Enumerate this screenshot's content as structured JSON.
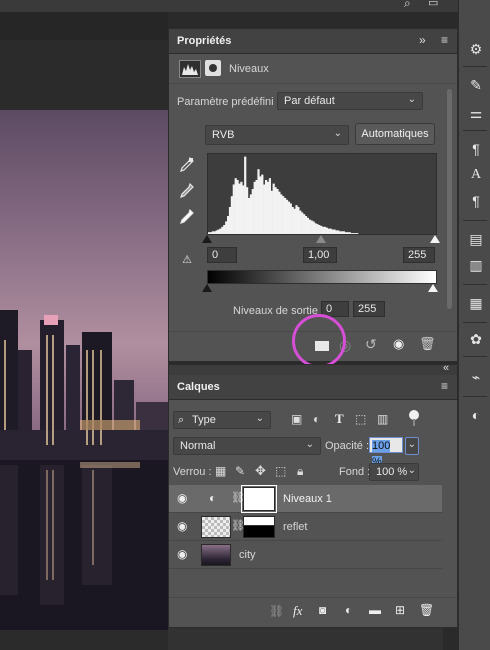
{
  "properties": {
    "title": "Propriétés",
    "collapse_glyph": "»",
    "menu_glyph": "≡",
    "layer_type_label": "Niveaux",
    "preset_label": "Paramètre prédéfini :",
    "preset_value": "Par défaut",
    "channel_value": "RVB",
    "auto_button": "Automatiques",
    "input_black": "0",
    "input_gamma": "1,00",
    "input_white": "255",
    "output_label": "Niveaux de sortie :",
    "output_black": "0",
    "output_white": "255",
    "histogram": [
      2,
      2,
      3,
      3,
      4,
      5,
      6,
      8,
      10,
      14,
      20,
      30,
      42,
      55,
      62,
      60,
      56,
      58,
      54,
      86,
      52,
      40,
      44,
      50,
      58,
      60,
      72,
      64,
      66,
      55,
      60,
      58,
      62,
      48,
      56,
      52,
      50,
      47,
      44,
      42,
      40,
      38,
      36,
      34,
      30,
      28,
      32,
      30,
      26,
      24,
      22,
      20,
      18,
      16,
      15,
      14,
      12,
      11,
      10,
      9,
      8,
      8,
      7,
      6,
      6,
      5,
      5,
      4,
      4,
      3,
      3,
      3,
      2,
      2,
      2,
      1,
      1,
      1,
      1,
      0,
      0,
      0,
      0,
      0,
      0,
      0,
      0,
      0,
      0,
      0,
      0,
      0,
      0,
      0,
      0,
      0,
      0,
      0,
      0,
      0,
      0,
      0,
      0,
      0,
      0,
      0,
      0,
      0,
      0,
      0,
      0,
      0,
      0,
      0,
      0,
      0,
      0,
      0,
      0,
      0
    ],
    "highlight_color": "#d64fd6"
  },
  "layers_panel": {
    "title": "Calques",
    "collapse_glyph": "«",
    "menu_glyph": "≡",
    "filter_value": "Type",
    "blend_mode": "Normal",
    "opacity_label": "Opacité :",
    "opacity_value": "100 %",
    "lock_label": "Verrou :",
    "fill_label": "Fond :",
    "fill_value": "100 %",
    "layers": [
      {
        "name": "Niveaux 1",
        "selected": true
      },
      {
        "name": "reflet",
        "selected": false
      },
      {
        "name": "city",
        "selected": false
      }
    ],
    "footer_fx": "fx"
  },
  "toolbar": {
    "icons": [
      "properties-icon",
      "brush-icon",
      "adjustments-sliders-icon",
      "paragraph-styles-icon",
      "character-icon",
      "paragraph-icon",
      "libraries-icon",
      "notes-icon",
      "grid-icon",
      "color-palette-icon",
      "paths-icon",
      "styles-icon"
    ]
  }
}
